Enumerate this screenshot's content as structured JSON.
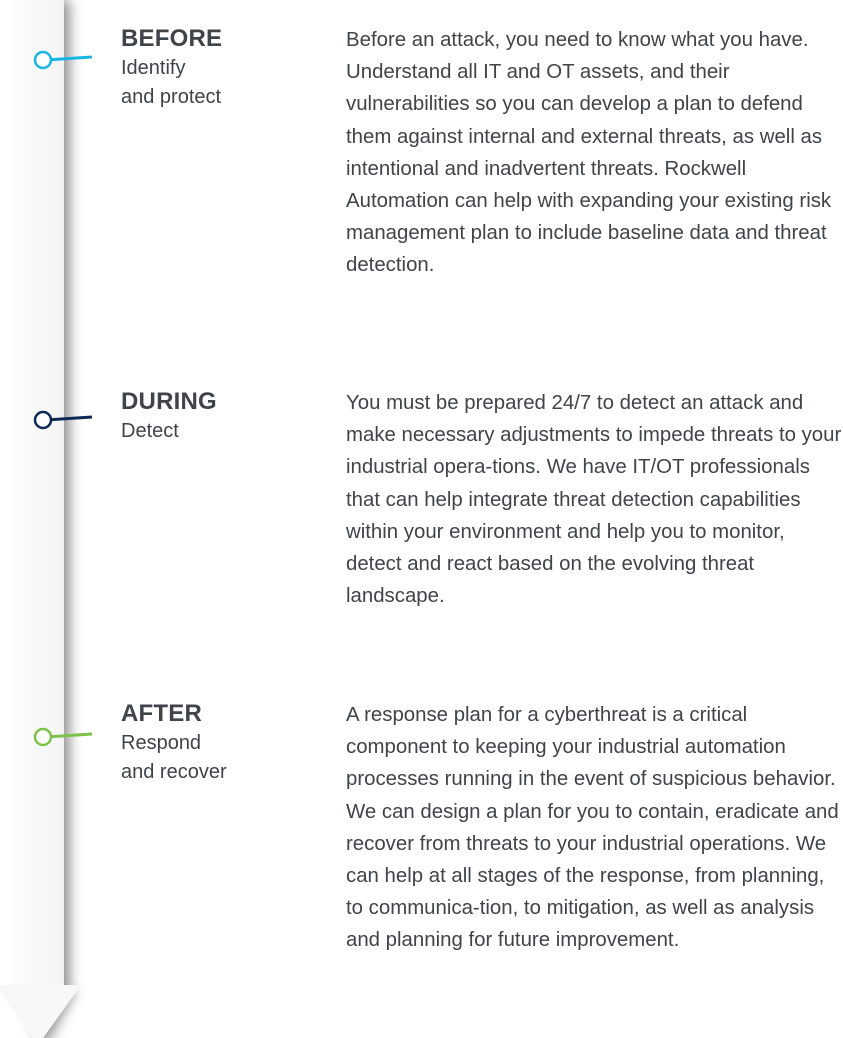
{
  "colors": {
    "text": "#3f4448",
    "before_accent": "#19b5e3",
    "during_accent": "#0d2a55",
    "after_accent": "#7dc24a",
    "timeline_bar": "#f5f5f5",
    "timeline_shadow": "#7a7a7a"
  },
  "stages": [
    {
      "title": "BEFORE",
      "subtitle": "Identify\nand protect",
      "description": "Before an attack, you need to know what you have. Understand all IT and OT assets, and their vulnerabilities so you can develop a plan to defend them against internal and external threats, as well as intentional and inadvertent threats. Rockwell Automation can help with expanding your existing risk management plan to include baseline data and threat detection."
    },
    {
      "title": "DURING",
      "subtitle": "Detect",
      "description": "You must be prepared 24/7 to detect an attack and make necessary adjustments to impede threats to your industrial opera-tions. We have IT/OT professionals that can help integrate threat detection capabilities within your environment and help you to monitor, detect and react based on the evolving threat landscape."
    },
    {
      "title": "AFTER",
      "subtitle": "Respond\nand recover",
      "description": "A response plan for a cyberthreat is a critical component to keeping your industrial automation processes running in the event of suspicious behavior. We can design a plan for you to contain, eradicate and recover from threats to your industrial operations. We can help at all stages of the response, from planning, to communica-tion, to mitigation, as well as analysis and planning for future improvement."
    }
  ]
}
